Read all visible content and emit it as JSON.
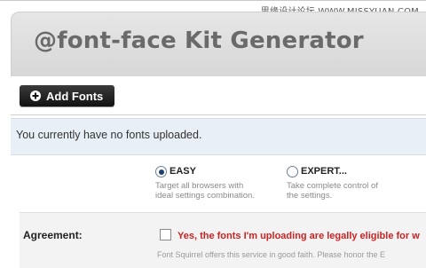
{
  "watermark": "思缘设计论坛 WWW.MISSYUAN.COM",
  "header": {
    "title": "@font-face Kit Generator"
  },
  "toolbar": {
    "add_fonts_label": "Add Fonts",
    "add_icon": "plus-circle-icon"
  },
  "notice": {
    "text": "You currently have no fonts uploaded."
  },
  "modes": {
    "easy": {
      "label": "EASY",
      "selected": true,
      "desc1": "Target all browsers with",
      "desc2": "ideal settings combination."
    },
    "expert": {
      "label": "EXPERT...",
      "selected": false,
      "desc1": "Take complete control of",
      "desc2": "the settings."
    }
  },
  "agreement": {
    "label": "Agreement:",
    "checkbox_text": "Yes, the fonts I'm uploading are legally eligible for w",
    "note": "Font Squirrel offers this service in good faith. Please honor the E"
  },
  "colors": {
    "accent_red": "#cc2222",
    "notice_bg": "#e9eff7",
    "button_bg": "#1e1e1e"
  }
}
